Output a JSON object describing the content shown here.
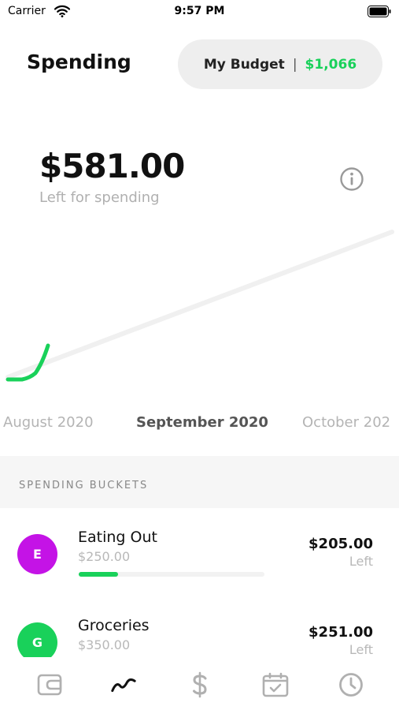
{
  "status_bar": {
    "carrier": "Carrier",
    "time": "9:57 PM"
  },
  "header": {
    "title": "Spending",
    "budget_label": "My Budget",
    "budget_separator": "|",
    "budget_value": "$1,066"
  },
  "summary": {
    "amount": "$581.00",
    "caption": "Left for spending"
  },
  "months": {
    "previous": "August 2020",
    "current": "September 2020",
    "next": "October 202"
  },
  "section": {
    "title": "SPENDING BUCKETS"
  },
  "buckets": [
    {
      "initial": "E",
      "name": "Eating Out",
      "budget": "$250.00",
      "remaining": "$205.00",
      "left_label": "Left",
      "progress_fraction": 0.21,
      "color": "#c413e6"
    },
    {
      "initial": "G",
      "name": "Groceries",
      "budget": "$350.00",
      "remaining": "$251.00",
      "left_label": "Left",
      "color": "#19d15a"
    }
  ],
  "tabs": [
    {
      "icon": "wallet-icon"
    },
    {
      "icon": "trend-icon",
      "active": true
    },
    {
      "icon": "dollar-icon"
    },
    {
      "icon": "calendar-check-icon"
    },
    {
      "icon": "clock-icon"
    }
  ],
  "colors": {
    "accent": "#19d15a",
    "bucket_e": "#c413e6",
    "bucket_g": "#19d15a",
    "muted_text": "#b0b0b0",
    "pill_bg": "#eeeeee"
  }
}
